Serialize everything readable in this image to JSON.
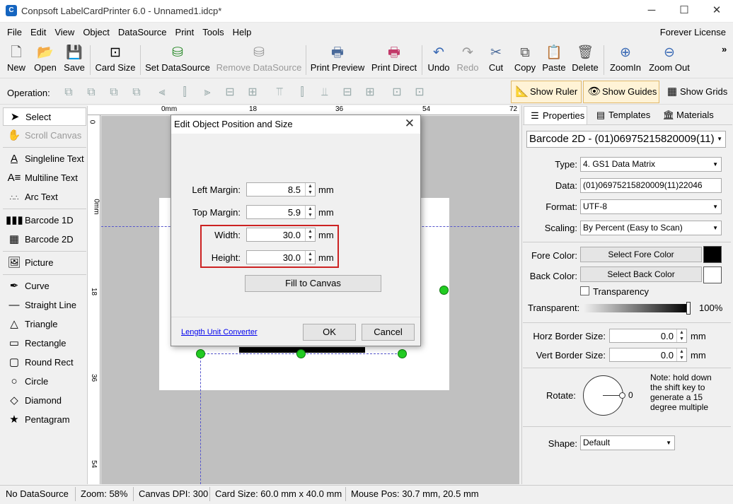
{
  "window": {
    "title": "Conpsoft LabelCardPrinter 6.0 - Unnamed1.idcp*",
    "minimize": "─",
    "maximize": "☐",
    "close": "✕"
  },
  "menu": {
    "items": [
      "File",
      "Edit",
      "View",
      "Object",
      "DataSource",
      "Print",
      "Tools",
      "Help"
    ],
    "license": "Forever License"
  },
  "toolbar": {
    "buttons": [
      {
        "label": "New",
        "icon": "new-file-icon",
        "glyph": "🗋"
      },
      {
        "label": "Open",
        "icon": "open-icon",
        "glyph": "📂"
      },
      {
        "label": "Save",
        "icon": "save-icon",
        "glyph": "💾"
      },
      {
        "label": "Card Size",
        "icon": "card-size-icon",
        "glyph": "⊡"
      },
      {
        "label": "Set DataSource",
        "icon": "database-icon",
        "glyph": "⛁"
      },
      {
        "label": "Remove DataSource",
        "icon": "database-remove-icon",
        "glyph": "⛁"
      },
      {
        "label": "Print Preview",
        "icon": "print-preview-icon",
        "glyph": "🖶"
      },
      {
        "label": "Print Direct",
        "icon": "printer-icon",
        "glyph": "🖶"
      },
      {
        "label": "Undo",
        "icon": "undo-icon",
        "glyph": "↶"
      },
      {
        "label": "Redo",
        "icon": "redo-icon",
        "glyph": "↷"
      },
      {
        "label": "Cut",
        "icon": "cut-icon",
        "glyph": "✂"
      },
      {
        "label": "Copy",
        "icon": "copy-icon",
        "glyph": "⧉"
      },
      {
        "label": "Paste",
        "icon": "paste-icon",
        "glyph": "📋"
      },
      {
        "label": "Delete",
        "icon": "trash-icon",
        "glyph": "🗑"
      },
      {
        "label": "ZoomIn",
        "icon": "zoom-in-icon",
        "glyph": "⊕"
      },
      {
        "label": "Zoom Out",
        "icon": "zoom-out-icon",
        "glyph": "⊖"
      }
    ],
    "overflow": "»"
  },
  "operation": {
    "label": "Operation:",
    "show_ruler": "Show Ruler",
    "show_guides": "Show Guides",
    "show_grids": "Show Grids"
  },
  "tools": {
    "select": "Select",
    "scroll_canvas": "Scroll Canvas",
    "singleline_text": "Singleline Text",
    "multiline_text": "Multiline Text",
    "arc_text": "Arc Text",
    "barcode_1d": "Barcode 1D",
    "barcode_2d": "Barcode 2D",
    "picture": "Picture",
    "curve": "Curve",
    "straight_line": "Straight Line",
    "triangle": "Triangle",
    "rectangle": "Rectangle",
    "round_rect": "Round Rect",
    "circle": "Circle",
    "diamond": "Diamond",
    "pentagram": "Pentagram"
  },
  "ruler": {
    "top": [
      "0mm",
      "18",
      "36",
      "54",
      "72"
    ],
    "left": [
      "0",
      "0mm",
      "18",
      "36",
      "54"
    ]
  },
  "dialog": {
    "title": "Edit Object Position and Size",
    "left_margin_label": "Left Margin:",
    "left_margin_value": "8.5",
    "top_margin_label": "Top Margin:",
    "top_margin_value": "5.9",
    "width_label": "Width:",
    "width_value": "30.0",
    "height_label": "Height:",
    "height_value": "30.0",
    "unit": "mm",
    "fill_button": "Fill to Canvas",
    "converter_link": "Length Unit Converter",
    "ok": "OK",
    "cancel": "Cancel"
  },
  "panel": {
    "tabs": [
      "Properties",
      "Templates",
      "Materials"
    ],
    "object_select": "Barcode 2D - (01)06975215820009(11)",
    "type_label": "Type:",
    "type_value": "4.  GS1 Data Matrix",
    "data_label": "Data:",
    "data_value": "(01)06975215820009(11)22046",
    "format_label": "Format:",
    "format_value": "UTF-8",
    "scaling_label": "Scaling:",
    "scaling_value": "By Percent (Easy to Scan)",
    "fore_label": "Fore Color:",
    "fore_button": "Select Fore Color",
    "fore_color": "#000000",
    "back_label": "Back Color:",
    "back_button": "Select Back Color",
    "back_color": "#ffffff",
    "transparency_label": "Transparency",
    "transparent_label": "Transparent:",
    "transparent_value": "100%",
    "horz_border_label": "Horz Border Size:",
    "horz_border_value": "0.0",
    "vert_border_label": "Vert Border Size:",
    "vert_border_value": "0.0",
    "border_unit": "mm",
    "rotate_label": "Rotate:",
    "rotate_value": "0",
    "rotate_note": "Note: hold down the shift key to generate a 15 degree multiple",
    "shape_label": "Shape:",
    "shape_value": "Default"
  },
  "status": {
    "datasource": "No DataSource",
    "zoom": "Zoom: 58%",
    "dpi": "Canvas DPI: 300",
    "card_size": "Card Size: 60.0 mm x 40.0 mm",
    "mouse_pos": "Mouse Pos: 30.7 mm, 20.5 mm"
  }
}
